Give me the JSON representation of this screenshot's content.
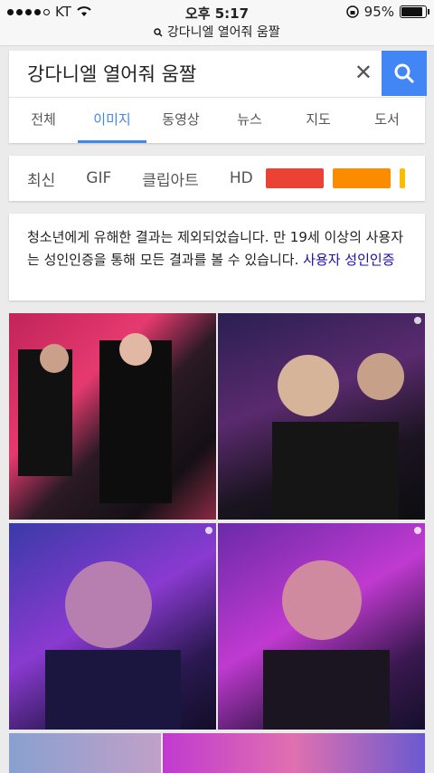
{
  "status": {
    "carrier": "KT",
    "time": "오후 5:17",
    "battery": "95%",
    "battery_level": 0.95
  },
  "url": {
    "text": "강다니엘 열어줘 움짤"
  },
  "search": {
    "query": "강다니엘 열어줘 움짤"
  },
  "tabs": [
    {
      "label": "전체",
      "active": false
    },
    {
      "label": "이미지",
      "active": true
    },
    {
      "label": "동영상",
      "active": false
    },
    {
      "label": "뉴스",
      "active": false
    },
    {
      "label": "지도",
      "active": false
    },
    {
      "label": "도서",
      "active": false
    }
  ],
  "filters": [
    {
      "label": "최신"
    },
    {
      "label": "GIF"
    },
    {
      "label": "클립아트"
    },
    {
      "label": "HD"
    }
  ],
  "color_filters": [
    "#ea4335",
    "#fb8c00",
    "#fbbc04"
  ],
  "notice": {
    "text": "청소년에게 유해한 결과는 제외되었습니다. 만 19세 이상의 사용자는 성인인증을 통해 모든 결과를 볼 수 있습니다.",
    "link": "사용자 성인인증"
  },
  "colors": {
    "accent": "#4285f4",
    "link": "#1a0dab"
  }
}
